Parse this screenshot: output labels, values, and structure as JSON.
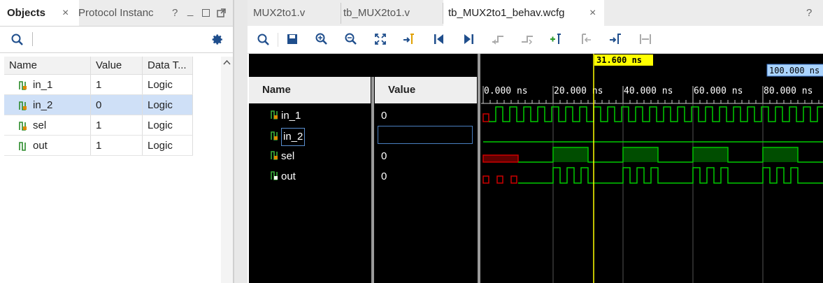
{
  "left_panel": {
    "tabs": [
      {
        "label": "Objects",
        "active": true
      },
      {
        "label": "Protocol Instanc",
        "active": false
      }
    ],
    "window_controls": {
      "help": "?",
      "minimize": "_"
    },
    "columns": [
      "Name",
      "Value",
      "Data T..."
    ],
    "rows": [
      {
        "name": "in_1",
        "value": "1",
        "type": "Logic",
        "selected": false
      },
      {
        "name": "in_2",
        "value": "0",
        "type": "Logic",
        "selected": true
      },
      {
        "name": "sel",
        "value": "1",
        "type": "Logic",
        "selected": false
      },
      {
        "name": "out",
        "value": "1",
        "type": "Logic",
        "selected": false
      }
    ]
  },
  "right_panel": {
    "tabs": [
      {
        "label": "MUX2to1.v",
        "active": false
      },
      {
        "label": "tb_MUX2to1.v",
        "active": false
      },
      {
        "label": "tb_MUX2to1_behav.wcfg",
        "active": true
      }
    ],
    "help": "?",
    "toolbar_icons": [
      "search-icon",
      "save-icon",
      "zoom-in-icon",
      "zoom-out-icon",
      "zoom-fit-icon",
      "go-to-cursor-icon",
      "go-to-start-icon",
      "go-to-end-icon",
      "previous-transition-icon",
      "next-transition-icon",
      "add-marker-icon",
      "previous-marker-icon",
      "next-marker-icon",
      "swap-cursors-icon"
    ]
  },
  "waveform": {
    "name_header": "Name",
    "value_header": "Value",
    "signals": [
      {
        "name": "in_1",
        "value": "0"
      },
      {
        "name": "in_2",
        "value": ""
      },
      {
        "name": "sel",
        "value": "0"
      },
      {
        "name": "out",
        "value": "0"
      }
    ],
    "cursor_label": "31.600 ns",
    "end_label": "100.000 ns",
    "time_ticks": [
      "0.000 ns",
      "20.000 ns",
      "40.000 ns",
      "60.000 ns",
      "80.000 ns"
    ],
    "colors": {
      "signal": "#00cc00",
      "undefined": "#cc0000",
      "cursor": "#ffff00",
      "background": "#000000"
    }
  }
}
